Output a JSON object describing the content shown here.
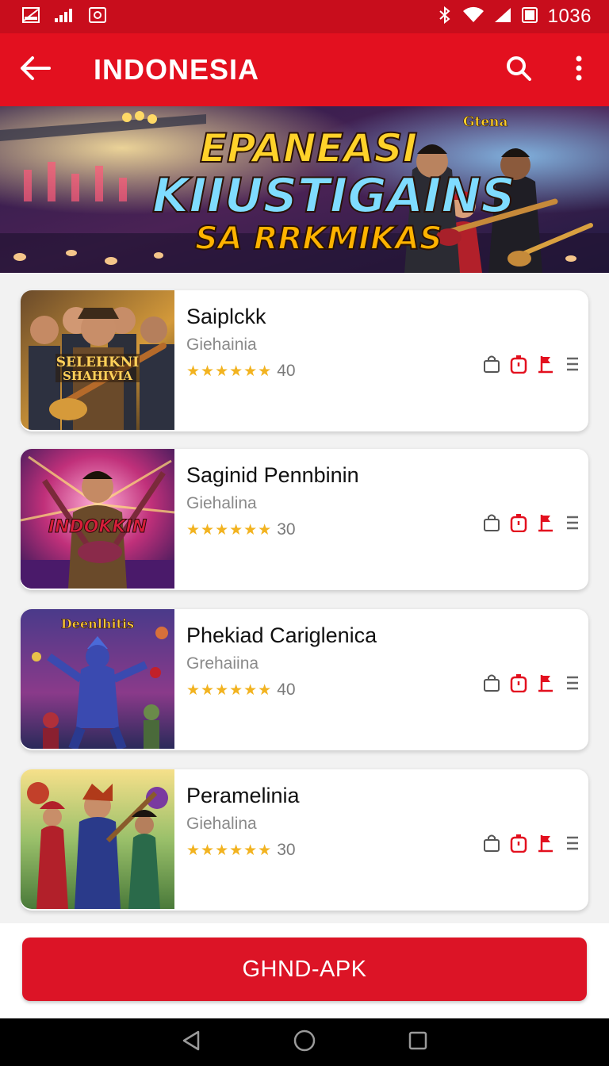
{
  "status_bar": {
    "time": "1036",
    "left_icons": [
      "image-icon",
      "signal-icon",
      "photo-icon"
    ],
    "right_icons": [
      "bluetooth-icon",
      "wifi-icon",
      "signal-icon",
      "battery-icon"
    ]
  },
  "app_bar": {
    "title": "INDONESIA",
    "back_icon": "arrow-left-icon",
    "actions": [
      "search-icon",
      "more-vertical-icon"
    ]
  },
  "banner": {
    "line1": "EPANEASI",
    "line2": "KIIUSTIGAINS",
    "line3": "SA RRKMIKAS",
    "logo": "Gtena"
  },
  "games": [
    {
      "title": "Saiplckk",
      "subtitle": "Giehainia",
      "stars": "★★★★★★",
      "rating": "40",
      "thumb_text": "SELEHKNI SHAHIVIA"
    },
    {
      "title": "Saginid Pennbinin",
      "subtitle": "Giehalina",
      "stars": "★★★★★★",
      "rating": "30",
      "thumb_text": "INDOKKIN"
    },
    {
      "title": "Phekiad Cariglenica",
      "subtitle": "Grehaiina",
      "stars": "★★★★★★",
      "rating": "40",
      "thumb_text": "Deenlhitis"
    },
    {
      "title": "Peramelinia",
      "subtitle": "Giehalina",
      "stars": "★★★★★★",
      "rating": "30",
      "thumb_text": ""
    }
  ],
  "card_icons": [
    "bag-icon",
    "timer-icon",
    "flag-icon",
    "menu-lines-icon"
  ],
  "apk_button": {
    "label": "GHND-APK"
  },
  "nav_bar": {
    "icons": [
      "back-triangle-icon",
      "home-circle-icon",
      "recents-square-icon"
    ]
  },
  "colors": {
    "primary_red": "#e3101f",
    "status_red": "#c80d1c",
    "star_gold": "#f2b320",
    "button_red": "#dc1426"
  }
}
